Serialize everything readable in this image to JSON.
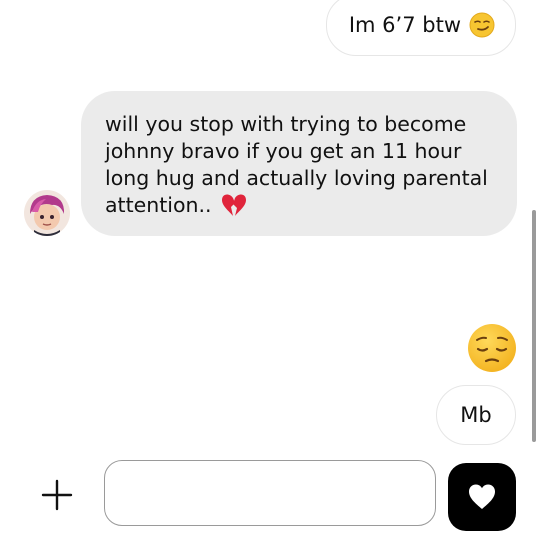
{
  "messages": {
    "outgoing_1": "Im 6’7 btw",
    "incoming_1": "will you stop with trying to become johnny bravo if you get an 11 hour long hug and actually loving parental attention..",
    "outgoing_2": "Mb"
  },
  "icons": {
    "smirk_emoji": "smirking-face-emoji",
    "broken_heart_emoji": "broken-heart-emoji",
    "pensive_emoji": "pensive-face-emoji",
    "plus": "plus-icon",
    "heart": "heart-icon"
  },
  "composer": {
    "value": "",
    "placeholder": ""
  },
  "colors": {
    "incoming_bubble": "#ebebeb",
    "send_button": "#000000",
    "emoji_yellow": "#f7c531"
  }
}
